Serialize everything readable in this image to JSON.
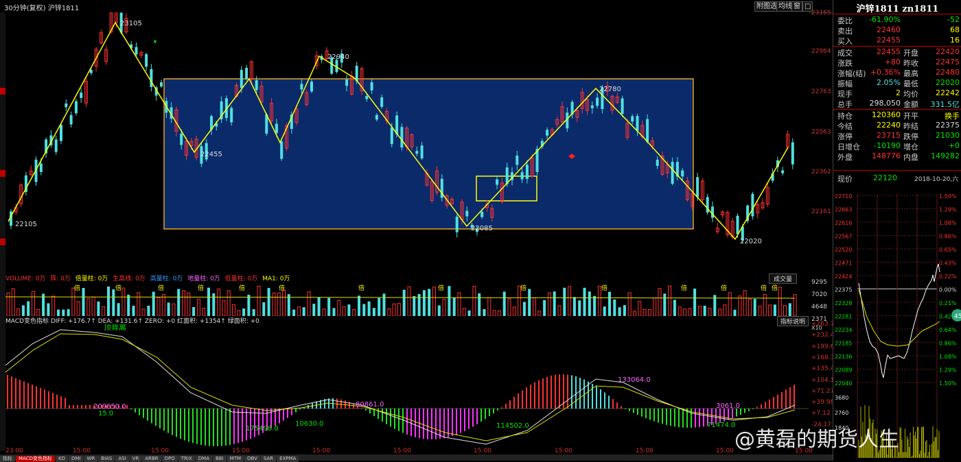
{
  "header": {
    "title": "30分钟(复权)  沪锌1811",
    "buttons": [
      "附图选",
      "均线",
      "窗",
      "□"
    ]
  },
  "main_axis": {
    "ticks": [
      "23165",
      "22964",
      "22763",
      "22563",
      "22362",
      "22161"
    ]
  },
  "main_annotations": {
    "p1": "23105",
    "p2": "22455",
    "p3": "22940",
    "p4": "22085",
    "p5": "22780",
    "p6": "22020",
    "p7": "22105"
  },
  "volume": {
    "header": [
      "VOLUME: 0万",
      "阵: 0万",
      "倍量柱: 0万",
      "生高线: 0万",
      "高量柱: 0万",
      "地量柱: 0万",
      "低量柱: 0万",
      "MA1: 0万"
    ],
    "button": "成交量",
    "ticks": [
      "9295",
      "7020",
      "4648",
      "2371",
      "X10"
    ],
    "bei_label": "倍"
  },
  "macd": {
    "header": "MACD变色指标  DIFF: +176.7↑  DEA: +131.6↑  ZERO: +0  红面积: +1354↑  绿面积: +0",
    "button": "指标说明",
    "divergence": "顶背离",
    "ticks": [
      "+263.7",
      "+232.4",
      "+199.6",
      "+168.3",
      "+135.4",
      "+104.1",
      "+71.27",
      "+39.98",
      "+7.12",
      "-24.17"
    ],
    "annotations": [
      "209650.0",
      "15.0",
      "175498.0",
      "10630.0",
      "80861.0",
      "114502.0",
      "133064.0",
      "3061.0",
      "71474.0"
    ]
  },
  "time_axis": [
    "23:00",
    "15:00",
    "15:00",
    "15:00",
    "15:00",
    "15:00",
    "15:00",
    "15:00",
    "15:00",
    "15:00",
    "15:00"
  ],
  "bottom_tabs": [
    "指标",
    "MACD变色指标",
    "KD",
    "DMI",
    "WR",
    "BIAS",
    "ASI",
    "VR",
    "ARBR",
    "DPO",
    "TRIX",
    "DMA",
    "BBI",
    "MTM",
    "OBV",
    "SAR",
    "EXPMA"
  ],
  "quote": {
    "title": "沪锌1811 zn1811",
    "rows": [
      {
        "l1": "委比",
        "v1": "-61.90%",
        "c1": "grn",
        "l2": "",
        "v2": "-52",
        "c2": "grn"
      },
      {
        "l1": "卖出",
        "v1": "22460",
        "c1": "red",
        "l2": "",
        "v2": "68",
        "c2": "yel"
      },
      {
        "l1": "买入",
        "v1": "22455",
        "c1": "red",
        "l2": "",
        "v2": "16",
        "c2": "yel"
      },
      {
        "l1": "成交",
        "v1": "22455",
        "c1": "red",
        "l2": "开盘",
        "v2": "22420",
        "c2": "red"
      },
      {
        "l1": "涨跌",
        "v1": "+80",
        "c1": "red",
        "l2": "昨收",
        "v2": "22475",
        "c2": "red"
      },
      {
        "l1": "涨幅(结)",
        "v1": "+0.36%",
        "c1": "red",
        "l2": "最高",
        "v2": "22480",
        "c2": "red"
      },
      {
        "l1": "振幅",
        "v1": "2.05%",
        "c1": "cyn",
        "l2": "最低",
        "v2": "22020",
        "c2": "grn"
      },
      {
        "l1": "现手",
        "v1": "2",
        "c1": "yel",
        "l2": "均价",
        "v2": "22242",
        "c2": "yel"
      },
      {
        "l1": "总手",
        "v1": "298,050",
        "c1": "wht",
        "l2": "金额",
        "v2": "331.5亿",
        "c2": "cyn"
      },
      {
        "l1": "持仓",
        "v1": "120360",
        "c1": "yel",
        "l2": "开平",
        "v2": "换手",
        "c2": "yel"
      },
      {
        "l1": "今结",
        "v1": "22240",
        "c1": "yel",
        "l2": "昨结",
        "v2": "22375",
        "c2": "wht"
      },
      {
        "l1": "涨停",
        "v1": "23715",
        "c1": "red",
        "l2": "跌停",
        "v2": "21030",
        "c2": "grn"
      },
      {
        "l1": "日增仓",
        "v1": "-10190",
        "c1": "grn",
        "l2": "增仓",
        "v2": "+0",
        "c2": "grn"
      },
      {
        "l1": "外盘",
        "v1": "148776",
        "c1": "red",
        "l2": "内盘",
        "v2": "149282",
        "c2": "grn"
      }
    ],
    "now_label": "现价",
    "now_value": "22120",
    "date": "2018-10-20,六"
  },
  "mini": {
    "left_ticks": [
      "22710",
      "22663",
      "22616",
      "22567",
      "22520",
      "22471",
      "22424",
      "22375",
      "22328",
      "22281",
      "22234",
      "22185",
      "22136",
      "22089",
      "22040"
    ],
    "right_ticks": [
      "1.50%",
      "1.29%",
      "1.08%",
      "0.86%",
      "0.65%",
      "0.43%",
      "0.22%",
      "0.00%",
      "0.21%",
      "0.42%",
      "0.64%",
      "0.86%",
      "1.08%",
      "1.29%",
      "1.50%"
    ],
    "vol_ticks": [
      "3680",
      "2760",
      "1840"
    ],
    "badge": "45"
  },
  "watermark": "@黄磊的期货人生"
}
